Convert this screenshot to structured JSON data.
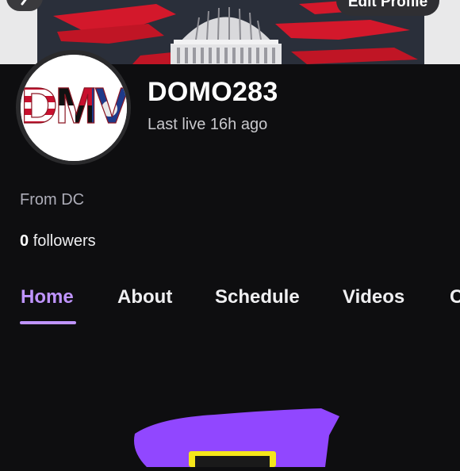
{
  "header": {
    "back_icon": "chevron-left-icon",
    "edit_profile_label": "Edit Profile"
  },
  "banner": {
    "colors": {
      "sky": "#2a2f3a",
      "accent": "#d3182b",
      "frame": "#e9e9ea"
    }
  },
  "profile": {
    "avatar_text": "DMV",
    "username": "DOMO283",
    "last_live": "Last live 16h ago",
    "location": "From DC",
    "followers_count": "0",
    "followers_label": "followers"
  },
  "tabs": [
    {
      "label": "Home",
      "active": true
    },
    {
      "label": "About",
      "active": false
    },
    {
      "label": "Schedule",
      "active": false
    },
    {
      "label": "Videos",
      "active": false
    },
    {
      "label": "C",
      "active": false
    }
  ],
  "theme": {
    "accent": "#bf94ff",
    "background": "#0e0e10",
    "promo_purple": "#9147ff",
    "promo_yellow": "#f5e61a"
  }
}
